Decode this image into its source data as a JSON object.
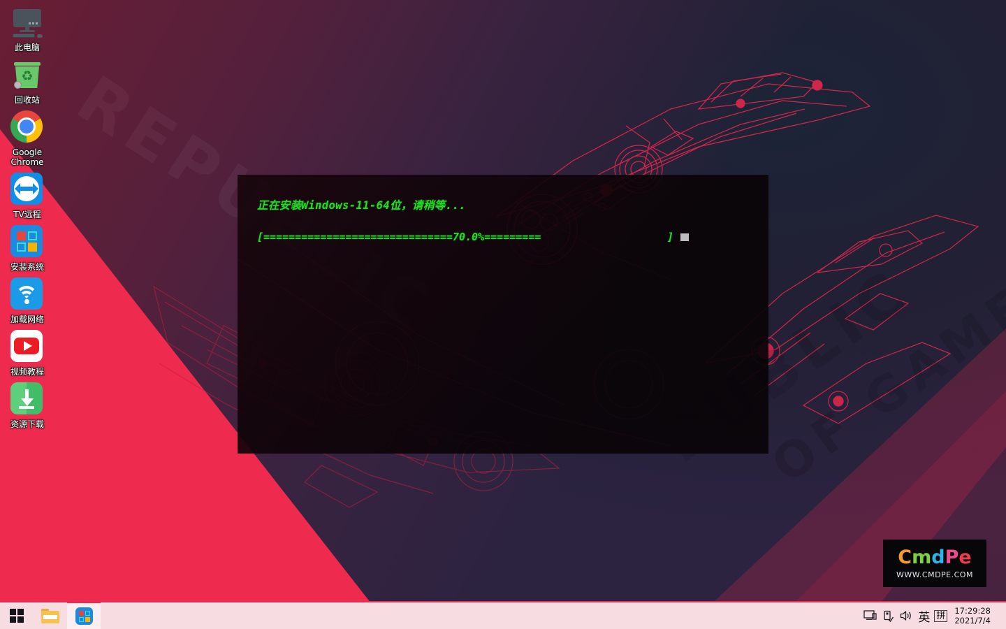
{
  "desktop": {
    "icons": [
      {
        "label": "此电脑",
        "icon": "computer-icon"
      },
      {
        "label": "回收站",
        "icon": "recycle-bin-icon"
      },
      {
        "label": "Google Chrome",
        "icon": "chrome-icon"
      },
      {
        "label": "TV远程",
        "icon": "teamviewer-icon"
      },
      {
        "label": "安装系统",
        "icon": "install-system-icon"
      },
      {
        "label": "加载网络",
        "icon": "wifi-icon"
      },
      {
        "label": "视频教程",
        "icon": "youtube-icon"
      },
      {
        "label": "资源下载",
        "icon": "download-icon"
      }
    ],
    "wallpaper_watermarks": [
      "REPUBLIC",
      "PUBLIC",
      "OF GAMERS"
    ],
    "colors": {
      "red": "#ee2a4e",
      "navy": "#222034",
      "maroon": "#6d1d33",
      "wireframe": "#e0274c"
    }
  },
  "console": {
    "title": "正在安装Windows-11-64位，请稍等...",
    "progress_line": "[==============================70.0%=========                    ]",
    "progress_percent": "70.0%",
    "text_color": "#22dd22",
    "cursor": "▌"
  },
  "cmdpe_logo": {
    "letters": [
      "C",
      "m",
      "d",
      "P",
      "e"
    ],
    "url": "WWW.CMDPE.COM",
    "letter_colors": [
      "#f39c2b",
      "#7fd13b",
      "#2fb4e9",
      "#ec4c8c",
      "#ee3b4e"
    ]
  },
  "taskbar": {
    "start_label": "start-button",
    "items": [
      {
        "name": "file-explorer",
        "icon": "folder-icon"
      },
      {
        "name": "install-system-app",
        "icon": "install-system-icon",
        "active": true
      }
    ],
    "tray": {
      "icons": [
        "display-icon",
        "usb-safely-remove-icon",
        "volume-icon"
      ],
      "ime_language": "英",
      "ime_mode": "拼",
      "time": "17:29:28",
      "date": "2021/7/4"
    }
  }
}
